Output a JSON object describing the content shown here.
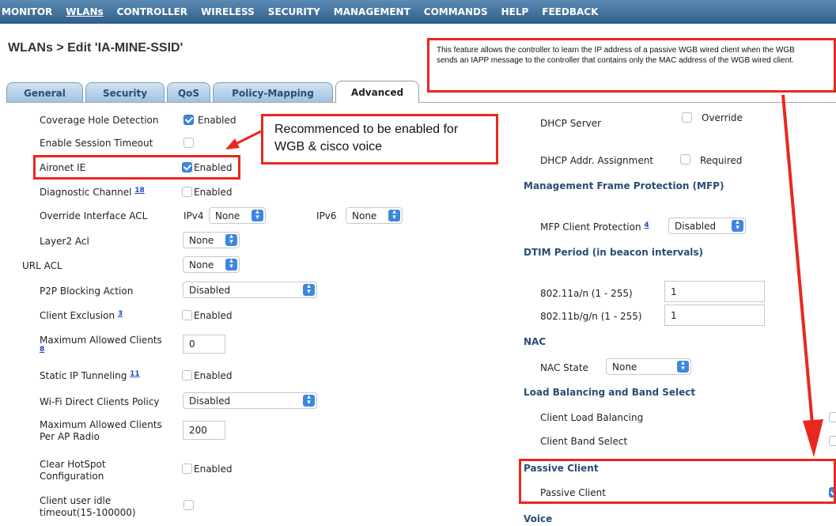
{
  "nav": {
    "items": [
      "MONITOR",
      "WLANs",
      "CONTROLLER",
      "WIRELESS",
      "SECURITY",
      "MANAGEMENT",
      "COMMANDS",
      "HELP",
      "FEEDBACK"
    ]
  },
  "page_title": "WLANs > Edit  'IA-MINE-SSID'",
  "tabs": [
    "General",
    "Security",
    "QoS",
    "Policy-Mapping",
    "Advanced"
  ],
  "left": {
    "coverage_hole": {
      "label": "Coverage Hole Detection",
      "value": "Enabled"
    },
    "session_timeout": {
      "label": "Enable Session Timeout"
    },
    "aironet_ie": {
      "label": "Aironet IE",
      "value": "Enabled"
    },
    "diagnostic_channel": {
      "label": "Diagnostic Channel",
      "sup": "18",
      "value": "Enabled"
    },
    "override_acl": {
      "label": "Override Interface ACL",
      "ipv4_label": "IPv4",
      "ipv4_value": "None",
      "ipv6_label": "IPv6",
      "ipv6_value": "None"
    },
    "layer2_acl": {
      "label": "Layer2 Acl",
      "value": "None"
    },
    "url_acl": {
      "label": "URL ACL",
      "value": "None"
    },
    "p2p_blocking": {
      "label": "P2P Blocking Action",
      "value": "Disabled"
    },
    "client_exclusion": {
      "label": "Client Exclusion",
      "sup": "3",
      "value": "Enabled"
    },
    "max_clients": {
      "label_line1": "Maximum Allowed Clients",
      "sup": "8",
      "value": "0"
    },
    "static_ip_tunneling": {
      "label": "Static IP Tunneling",
      "sup": "11",
      "value": "Enabled"
    },
    "wifi_direct": {
      "label": "Wi-Fi Direct Clients Policy",
      "value": "Disabled"
    },
    "max_clients_ap": {
      "label_line1": "Maximum Allowed Clients",
      "label_line2": "Per AP Radio",
      "value": "200"
    },
    "clear_hotspot": {
      "label_line1": "Clear HotSpot",
      "label_line2": "Configuration",
      "value": "Enabled"
    },
    "idle_timeout": {
      "label_line1": "Client user idle",
      "label_line2": "timeout(15-100000)"
    }
  },
  "right": {
    "dhcp_server": {
      "label": "DHCP Server",
      "value": "Override"
    },
    "dhcp_assignment": {
      "label": "DHCP Addr. Assignment",
      "value": "Required"
    },
    "mfp_section": "Management Frame Protection (MFP)",
    "mfp_client": {
      "label": "MFP Client Protection",
      "sup": "4",
      "value": "Disabled"
    },
    "dtim_section": "DTIM Period (in beacon intervals)",
    "dtim_an": {
      "label": "802.11a/n (1 - 255)",
      "value": "1"
    },
    "dtim_bgn": {
      "label": "802.11b/g/n (1 - 255)",
      "value": "1"
    },
    "nac_section": "NAC",
    "nac_state": {
      "label": "NAC State",
      "value": "None"
    },
    "lb_section": "Load Balancing and Band Select",
    "client_lb": {
      "label": "Client Load Balancing"
    },
    "client_bs": {
      "label": "Client Band Select"
    },
    "passive_section": "Passive Client",
    "passive_client": {
      "label": "Passive Client"
    },
    "voice_section": "Voice"
  },
  "annotations": {
    "recommend_line1": "Recommenced to be enabled for",
    "recommend_line2": "WGB & cisco voice",
    "feature_note": "This feature allows the controller to learn the IP address of a passive WGB wired client when the WGB sends an IAPP message to the controller that contains only the MAC address of the WGB wired client."
  },
  "colors": {
    "nav_bg": "#3b6b97",
    "accent": "#3d87e0",
    "section": "#2a4d75",
    "highlight": "#e8281e"
  }
}
